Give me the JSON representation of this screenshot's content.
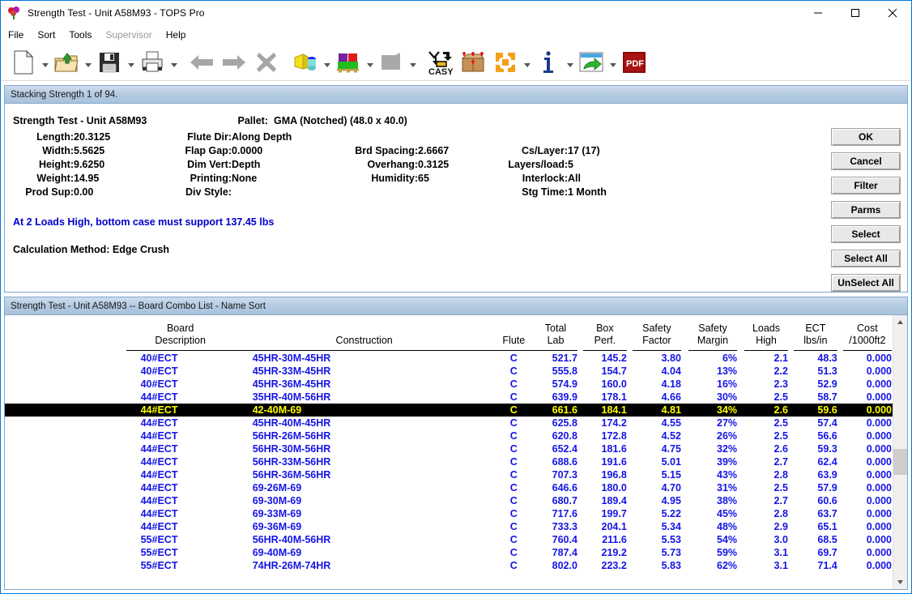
{
  "window": {
    "title": "Strength Test - Unit A58M93 - TOPS Pro",
    "app_icon": "balloons-icon",
    "minimize_label": "—",
    "maximize_label": "□",
    "close_label": "✕"
  },
  "menubar": {
    "items": [
      {
        "label": "File",
        "disabled": false
      },
      {
        "label": "Sort",
        "disabled": false
      },
      {
        "label": "Tools",
        "disabled": false
      },
      {
        "label": "Supervisor",
        "disabled": true
      },
      {
        "label": "Help",
        "disabled": false
      }
    ]
  },
  "toolbar": {
    "items": [
      {
        "name": "new-document-icon",
        "dropdown": true
      },
      {
        "name": "open-folder-icon",
        "dropdown": true
      },
      {
        "name": "save-floppy-icon",
        "dropdown": true
      },
      {
        "name": "print-icon",
        "dropdown": true
      },
      {
        "name": "back-arrow-icon",
        "dropdown": false
      },
      {
        "name": "forward-arrow-icon",
        "dropdown": false
      },
      {
        "name": "delete-x-icon",
        "dropdown": false
      },
      {
        "name": "pallet-load-icon",
        "dropdown": true
      },
      {
        "name": "case-on-pallet-icon",
        "dropdown": true
      },
      {
        "name": "box-gray-icon",
        "dropdown": true
      },
      {
        "name": "casy-icon",
        "dropdown": false
      },
      {
        "name": "carton-analysis-icon",
        "dropdown": false
      },
      {
        "name": "apps-grid-icon",
        "dropdown": true
      },
      {
        "name": "info-icon",
        "dropdown": true
      },
      {
        "name": "export-window-icon",
        "dropdown": true
      },
      {
        "name": "pdf-icon",
        "dropdown": false
      }
    ]
  },
  "top_panel": {
    "caption": "Stacking Strength 1 of 94.",
    "heading": "Strength Test - Unit A58M93",
    "pallet_label": "Pallet:",
    "pallet_value": "GMA (Notched) (48.0 x 40.0)",
    "rows": [
      {
        "l1": "Length:",
        "v1": "20.3125",
        "l2": "Flute Dir:",
        "v2": "Along Depth",
        "l3": "",
        "v3": "",
        "l4": "",
        "v4": ""
      },
      {
        "l1": "Width:",
        "v1": "5.5625",
        "l2": "Flap Gap:",
        "v2": "0.0000",
        "l3": "Brd Spacing:",
        "v3": "2.6667",
        "l4": "Cs/Layer:",
        "v4": "17 (17)"
      },
      {
        "l1": "Height:",
        "v1": "9.6250",
        "l2": "Dim Vert:",
        "v2": "Depth",
        "l3": "Overhang:",
        "v3": "0.3125",
        "l4": "Layers/load:",
        "v4": "5"
      },
      {
        "l1": "Weight:",
        "v1": "14.95",
        "l2": "Printing:",
        "v2": "None",
        "l3": "Humidity:",
        "v3": "65",
        "l4": "Interlock:",
        "v4": "All"
      },
      {
        "l1": "Prod Sup:",
        "v1": "0.00",
        "l2": "Div Style:",
        "v2": "",
        "l3": "",
        "v3": "",
        "l4": "Stg Time:",
        "v4": "1 Month"
      }
    ],
    "note": "At 2 Loads High, bottom case must support 137.45 lbs",
    "note_color": "#0000cc",
    "calculation_method": "Calculation Method: Edge Crush"
  },
  "buttons": [
    {
      "label": "OK",
      "name": "ok-button"
    },
    {
      "label": "Cancel",
      "name": "cancel-button"
    },
    {
      "label": "Filter",
      "name": "filter-button"
    },
    {
      "label": "Parms",
      "name": "parms-button"
    },
    {
      "label": "Select",
      "name": "select-button"
    },
    {
      "label": "Select All",
      "name": "select-all-button"
    },
    {
      "label": "UnSelect All",
      "name": "unselect-all-button"
    }
  ],
  "bottom_panel": {
    "caption": "Strength Test - Unit A58M93 -- Board Combo List - Name Sort",
    "columns": [
      "Board\nDescription",
      "Construction",
      "Flute",
      "Total\nLab",
      "Box\nPerf.",
      "Safety\nFactor",
      "Safety\nMargin",
      "Loads\nHigh",
      "ECT\nlbs/in",
      "Cost\n/1000ft2"
    ],
    "rows": [
      {
        "desc": "40#ECT",
        "cons": "45HR-30M-45HR",
        "flute": "C",
        "total_lab": "521.7",
        "box_perf": "145.2",
        "safety_factor": "3.80",
        "safety_margin": "6%",
        "loads_high": "2.1",
        "ect": "48.3",
        "cost": "0.000",
        "selected": false
      },
      {
        "desc": "40#ECT",
        "cons": "45HR-33M-45HR",
        "flute": "C",
        "total_lab": "555.8",
        "box_perf": "154.7",
        "safety_factor": "4.04",
        "safety_margin": "13%",
        "loads_high": "2.2",
        "ect": "51.3",
        "cost": "0.000",
        "selected": false
      },
      {
        "desc": "40#ECT",
        "cons": "45HR-36M-45HR",
        "flute": "C",
        "total_lab": "574.9",
        "box_perf": "160.0",
        "safety_factor": "4.18",
        "safety_margin": "16%",
        "loads_high": "2.3",
        "ect": "52.9",
        "cost": "0.000",
        "selected": false
      },
      {
        "desc": "44#ECT",
        "cons": "35HR-40M-56HR",
        "flute": "C",
        "total_lab": "639.9",
        "box_perf": "178.1",
        "safety_factor": "4.66",
        "safety_margin": "30%",
        "loads_high": "2.5",
        "ect": "58.7",
        "cost": "0.000",
        "selected": false
      },
      {
        "desc": "44#ECT",
        "cons": "42-40M-69",
        "flute": "C",
        "total_lab": "661.6",
        "box_perf": "184.1",
        "safety_factor": "4.81",
        "safety_margin": "34%",
        "loads_high": "2.6",
        "ect": "59.6",
        "cost": "0.000",
        "selected": true
      },
      {
        "desc": "44#ECT",
        "cons": "45HR-40M-45HR",
        "flute": "C",
        "total_lab": "625.8",
        "box_perf": "174.2",
        "safety_factor": "4.55",
        "safety_margin": "27%",
        "loads_high": "2.5",
        "ect": "57.4",
        "cost": "0.000",
        "selected": false
      },
      {
        "desc": "44#ECT",
        "cons": "56HR-26M-56HR",
        "flute": "C",
        "total_lab": "620.8",
        "box_perf": "172.8",
        "safety_factor": "4.52",
        "safety_margin": "26%",
        "loads_high": "2.5",
        "ect": "56.6",
        "cost": "0.000",
        "selected": false
      },
      {
        "desc": "44#ECT",
        "cons": "56HR-30M-56HR",
        "flute": "C",
        "total_lab": "652.4",
        "box_perf": "181.6",
        "safety_factor": "4.75",
        "safety_margin": "32%",
        "loads_high": "2.6",
        "ect": "59.3",
        "cost": "0.000",
        "selected": false
      },
      {
        "desc": "44#ECT",
        "cons": "56HR-33M-56HR",
        "flute": "C",
        "total_lab": "688.6",
        "box_perf": "191.6",
        "safety_factor": "5.01",
        "safety_margin": "39%",
        "loads_high": "2.7",
        "ect": "62.4",
        "cost": "0.000",
        "selected": false
      },
      {
        "desc": "44#ECT",
        "cons": "56HR-36M-56HR",
        "flute": "C",
        "total_lab": "707.3",
        "box_perf": "196.8",
        "safety_factor": "5.15",
        "safety_margin": "43%",
        "loads_high": "2.8",
        "ect": "63.9",
        "cost": "0.000",
        "selected": false
      },
      {
        "desc": "44#ECT",
        "cons": "69-26M-69",
        "flute": "C",
        "total_lab": "646.6",
        "box_perf": "180.0",
        "safety_factor": "4.70",
        "safety_margin": "31%",
        "loads_high": "2.5",
        "ect": "57.9",
        "cost": "0.000",
        "selected": false
      },
      {
        "desc": "44#ECT",
        "cons": "69-30M-69",
        "flute": "C",
        "total_lab": "680.7",
        "box_perf": "189.4",
        "safety_factor": "4.95",
        "safety_margin": "38%",
        "loads_high": "2.7",
        "ect": "60.6",
        "cost": "0.000",
        "selected": false
      },
      {
        "desc": "44#ECT",
        "cons": "69-33M-69",
        "flute": "C",
        "total_lab": "717.6",
        "box_perf": "199.7",
        "safety_factor": "5.22",
        "safety_margin": "45%",
        "loads_high": "2.8",
        "ect": "63.7",
        "cost": "0.000",
        "selected": false
      },
      {
        "desc": "44#ECT",
        "cons": "69-36M-69",
        "flute": "C",
        "total_lab": "733.3",
        "box_perf": "204.1",
        "safety_factor": "5.34",
        "safety_margin": "48%",
        "loads_high": "2.9",
        "ect": "65.1",
        "cost": "0.000",
        "selected": false
      },
      {
        "desc": "55#ECT",
        "cons": "56HR-40M-56HR",
        "flute": "C",
        "total_lab": "760.4",
        "box_perf": "211.6",
        "safety_factor": "5.53",
        "safety_margin": "54%",
        "loads_high": "3.0",
        "ect": "68.5",
        "cost": "0.000",
        "selected": false
      },
      {
        "desc": "55#ECT",
        "cons": "69-40M-69",
        "flute": "C",
        "total_lab": "787.4",
        "box_perf": "219.2",
        "safety_factor": "5.73",
        "safety_margin": "59%",
        "loads_high": "3.1",
        "ect": "69.7",
        "cost": "0.000",
        "selected": false
      },
      {
        "desc": "55#ECT",
        "cons": "74HR-26M-74HR",
        "flute": "C",
        "total_lab": "802.0",
        "box_perf": "223.2",
        "safety_factor": "5.83",
        "safety_margin": "62%",
        "loads_high": "3.1",
        "ect": "71.4",
        "cost": "0.000",
        "selected": false
      }
    ]
  },
  "colors": {
    "row_text": "#1414e6",
    "selected_row_text": "#ffff00",
    "selected_row_bg": "#000000",
    "note": "#0000cc",
    "caption_bg": "#b3cae0"
  }
}
